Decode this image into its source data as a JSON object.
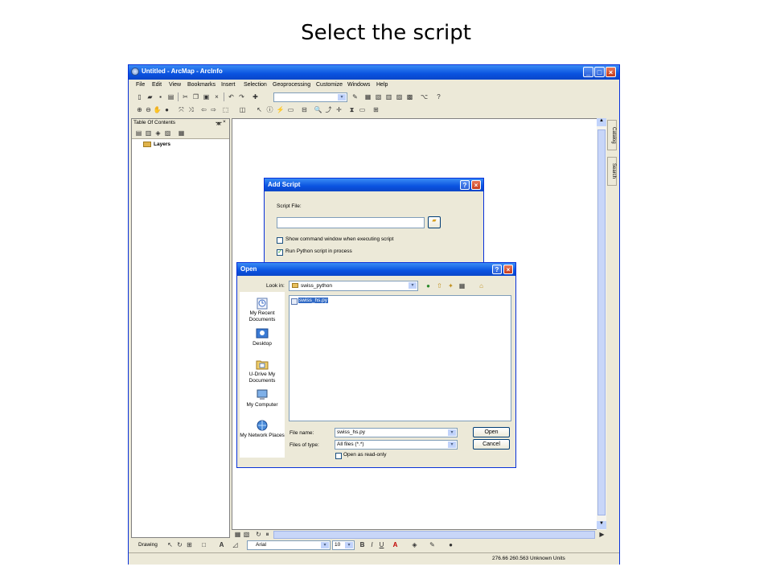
{
  "slide_title": "Select the script",
  "window": {
    "title": "Untitled - ArcMap - ArcInfo",
    "menu": [
      "File",
      "Edit",
      "View",
      "Bookmarks",
      "Insert",
      "Selection",
      "Geoprocessing",
      "Customize",
      "Windows",
      "Help"
    ]
  },
  "toc": {
    "title": "Table Of Contents",
    "layers_label": "Layers"
  },
  "side_tabs": [
    "Catalog",
    "Search"
  ],
  "drawing": {
    "label": "Drawing",
    "font": "Arial",
    "size": "10",
    "bold": "B",
    "italic": "I",
    "underline": "U",
    "font_color": "A"
  },
  "status": {
    "coords": "276.66  260.563 Unknown Units"
  },
  "add_script": {
    "title": "Add Script",
    "script_file_label": "Script File:",
    "script_file_value": "",
    "show_command_label": "Show command window when executing script",
    "show_command_checked": false,
    "run_in_process_label": "Run Python script in process",
    "run_in_process_checked": true
  },
  "open_dialog": {
    "title": "Open",
    "look_in_label": "Look in:",
    "look_in_value": "swiss_python",
    "places": [
      "My Recent Documents",
      "Desktop",
      "U-Drive My Documents",
      "My Computer",
      "My Network Places"
    ],
    "files": [
      "swiss_hs.py"
    ],
    "file_name_label": "File name:",
    "file_name_value": "swiss_hs.py",
    "files_of_type_label": "Files of type:",
    "files_of_type_value": "All files (*.*)",
    "read_only_label": "Open as read-only",
    "open_button": "Open",
    "cancel_button": "Cancel"
  }
}
